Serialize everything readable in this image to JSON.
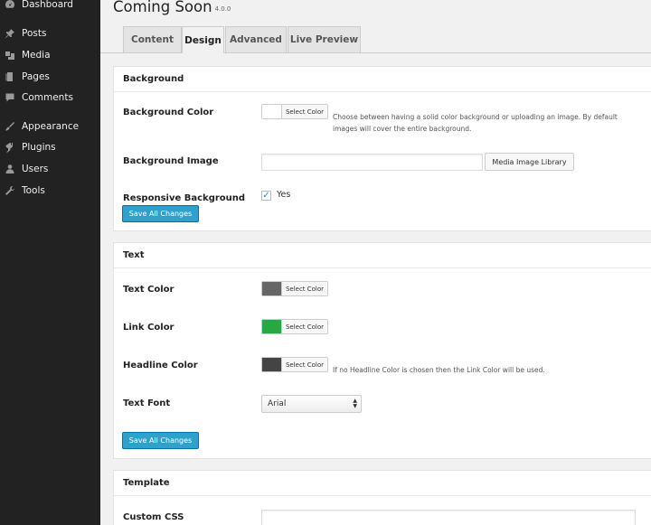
{
  "sidebar": {
    "items": [
      {
        "label": "Dashboard",
        "icon": "dashboard-icon"
      },
      {
        "label": "Posts",
        "icon": "pin-icon"
      },
      {
        "label": "Media",
        "icon": "media-icon"
      },
      {
        "label": "Pages",
        "icon": "page-icon"
      },
      {
        "label": "Comments",
        "icon": "comment-icon"
      },
      {
        "label": "Appearance",
        "icon": "brush-icon"
      },
      {
        "label": "Plugins",
        "icon": "plug-icon"
      },
      {
        "label": "Users",
        "icon": "user-icon"
      },
      {
        "label": "Tools",
        "icon": "wrench-icon"
      }
    ]
  },
  "header": {
    "title": "Coming Soon",
    "version": "4.0.0"
  },
  "tabs": [
    {
      "label": "Content",
      "active": false
    },
    {
      "label": "Design",
      "active": true
    },
    {
      "label": "Advanced",
      "active": false
    },
    {
      "label": "Live Preview",
      "active": false
    }
  ],
  "background_section": {
    "title": "Background",
    "color_label": "Background Color",
    "color_button": "Select Color",
    "color_value": "#ffffff",
    "color_desc_line1": "Choose between having a solid color background or uploading an image. By default",
    "color_desc_line2": "images will cover the entire background.",
    "image_label": "Background Image",
    "image_value": "",
    "image_button": "Media Image Library",
    "responsive_label": "Responsive Background",
    "responsive_checked": true,
    "responsive_option": "Yes",
    "save_button": "Save All Changes"
  },
  "text_section": {
    "title": "Text",
    "text_color_label": "Text Color",
    "text_color_value": "#666666",
    "link_color_label": "Link Color",
    "link_color_value": "#27a844",
    "headline_color_label": "Headline Color",
    "headline_color_value": "#444444",
    "headline_desc": "If no Headline Color is chosen then the Link Color will be used.",
    "select_color_button": "Select Color",
    "font_label": "Text Font",
    "font_value": "Arial",
    "save_button": "Save All Changes"
  },
  "template_section": {
    "title": "Template",
    "css_label": "Custom CSS"
  },
  "colors": {
    "sidebar_bg": "#222222",
    "primary": "#2ea2cc",
    "check": "#1e8cbe"
  }
}
